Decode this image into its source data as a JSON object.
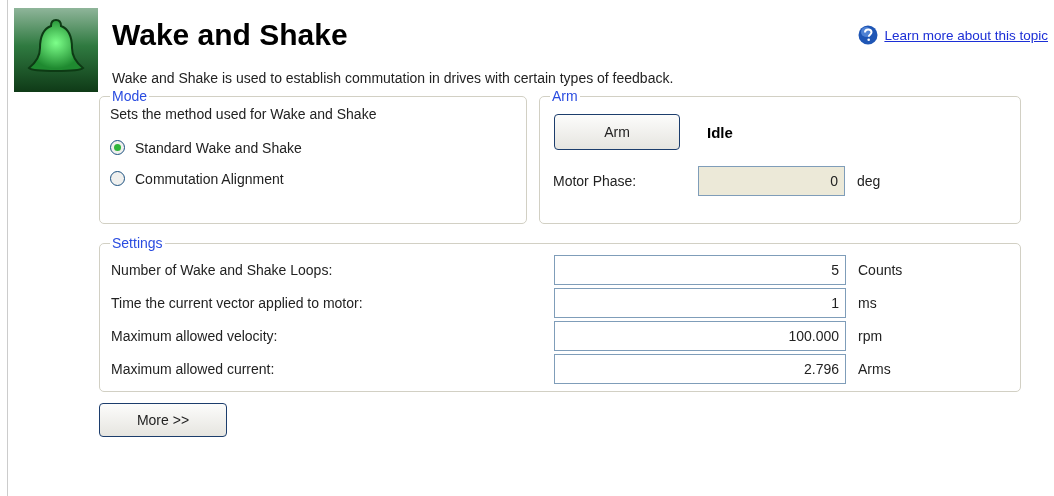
{
  "header": {
    "title": "Wake and Shake",
    "help_link": "Learn more about this topic",
    "description": "Wake and Shake is used to establish commutation in drives with certain types of feedback."
  },
  "mode": {
    "legend": "Mode",
    "hint": "Sets the method used for Wake and Shake",
    "options": [
      {
        "label": "Standard Wake and Shake",
        "selected": true
      },
      {
        "label": "Commutation Alignment",
        "selected": false
      }
    ]
  },
  "arm": {
    "legend": "Arm",
    "button": "Arm",
    "status": "Idle",
    "phase_label": "Motor Phase:",
    "phase_value": "0",
    "phase_unit": "deg"
  },
  "settings": {
    "legend": "Settings",
    "rows": [
      {
        "label": "Number of Wake and Shake Loops:",
        "value": "5",
        "unit": "Counts"
      },
      {
        "label": "Time the current vector applied to motor:",
        "value": "1",
        "unit": "ms"
      },
      {
        "label": "Maximum allowed velocity:",
        "value": "100.000",
        "unit": "rpm"
      },
      {
        "label": "Maximum allowed current:",
        "value": "2.796",
        "unit": "Arms"
      }
    ]
  },
  "buttons": [
    "More >>"
  ]
}
